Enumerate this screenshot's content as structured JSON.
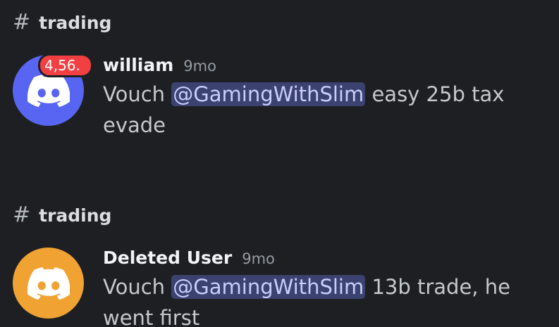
{
  "sections": [
    {
      "channel": {
        "hash": "#",
        "name": "trading"
      },
      "message": {
        "avatar": {
          "icon": "discord-logo-icon",
          "color": "#5865f2",
          "badge": "4,56."
        },
        "username": "william",
        "timestamp": "9mo",
        "text_prefix": "Vouch ",
        "mention": "@GamingWithSlim",
        "text_suffix": " easy 25b tax evade"
      }
    },
    {
      "channel": {
        "hash": "#",
        "name": "trading"
      },
      "message": {
        "avatar": {
          "icon": "discord-logo-icon",
          "color": "#f0a232"
        },
        "username": "Deleted User",
        "timestamp": "9mo",
        "text_prefix": "Vouch ",
        "mention": "@GamingWithSlim",
        "text_suffix": " 13b trade, he went first"
      }
    }
  ],
  "colors": {
    "background": "#1e1f22",
    "mention_bg": "#3c4270",
    "mention_text": "#c9cdfb",
    "badge": "#f23f42"
  }
}
